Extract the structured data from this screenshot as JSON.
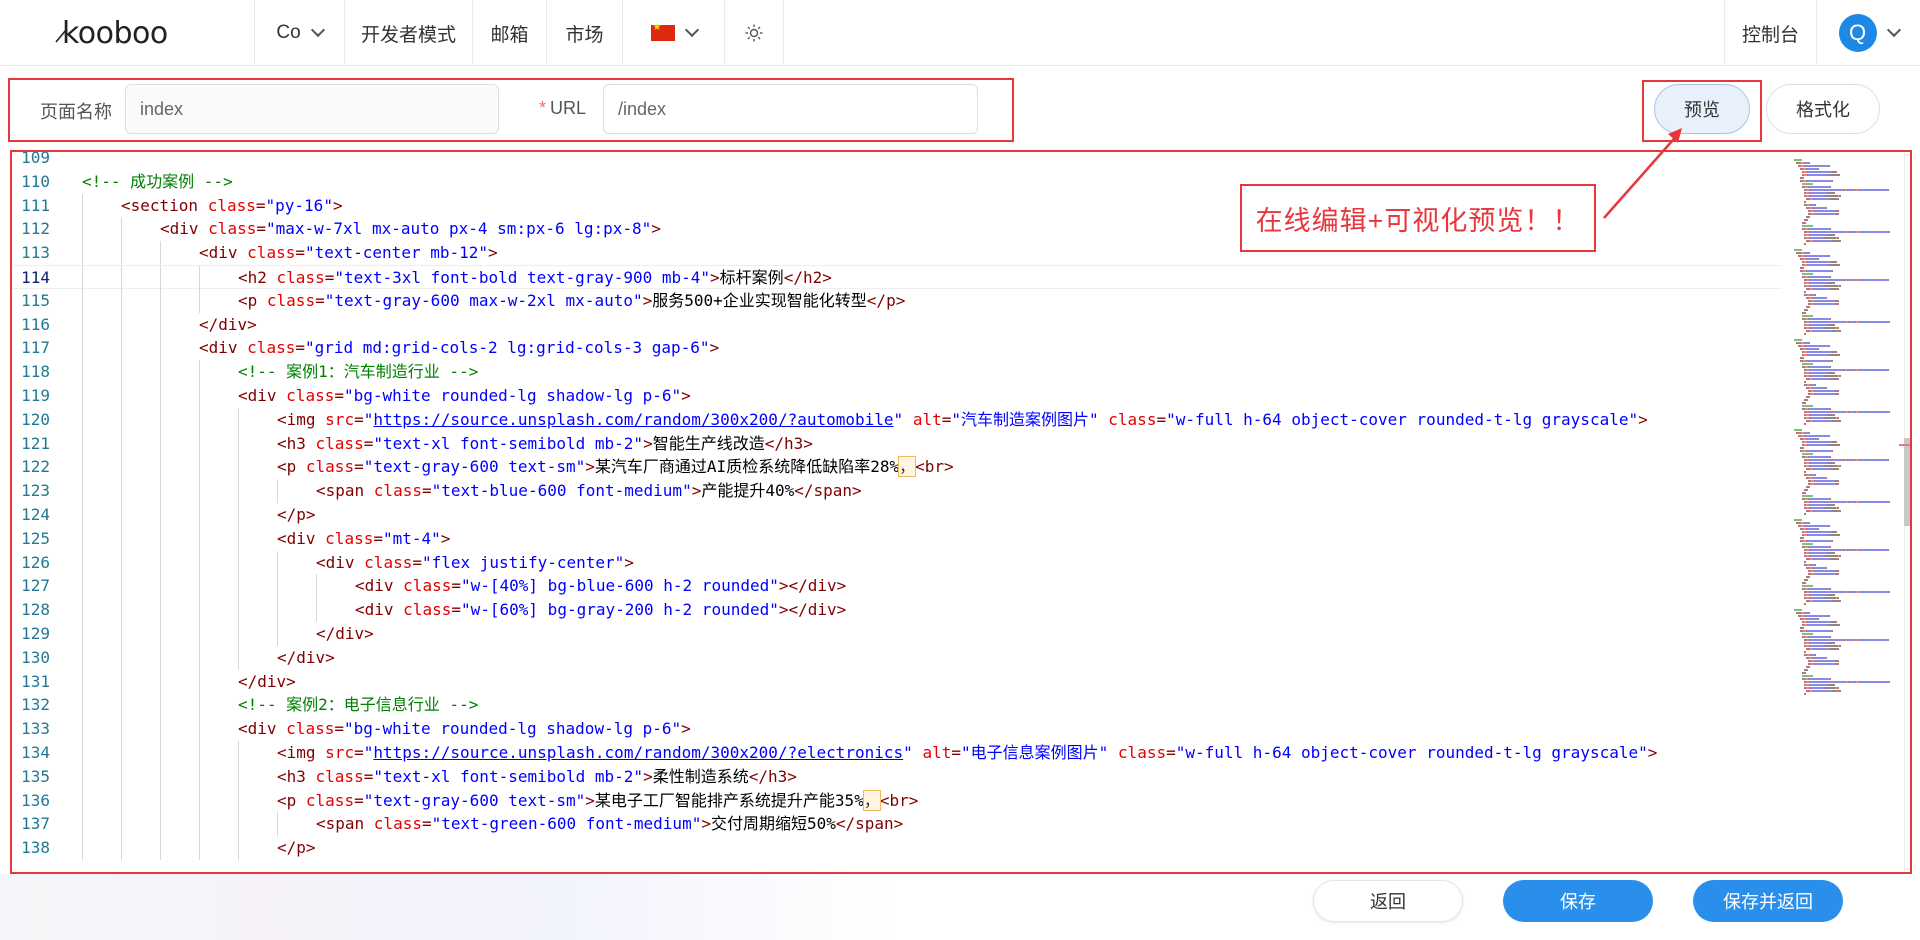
{
  "nav": {
    "logo": "kooboo",
    "lang_short": "Co",
    "dev_mode": "开发者模式",
    "mail": "邮箱",
    "market": "市场",
    "console": "控制台",
    "avatar_letter": "Q"
  },
  "form": {
    "page_name_label": "页面名称",
    "page_name_value": "index",
    "url_required_mark": "*",
    "url_label": "URL",
    "url_value": "/index",
    "preview_button": "预览",
    "format_button": "格式化"
  },
  "annotation": "在线编辑+可视化预览！！",
  "editor": {
    "active_line": 114,
    "lines": [
      {
        "n": "109",
        "indent": 0,
        "tokens": []
      },
      {
        "n": "110",
        "indent": 0,
        "tokens": [
          [
            "cm",
            "<!-- 成功案例 -->"
          ]
        ]
      },
      {
        "n": "111",
        "indent": 1,
        "tokens": [
          [
            "tag",
            "<section "
          ],
          [
            "attr",
            "class"
          ],
          [
            "tag",
            "="
          ],
          [
            "val",
            "\"py-16\""
          ],
          [
            "tag",
            ">"
          ]
        ]
      },
      {
        "n": "112",
        "indent": 2,
        "tokens": [
          [
            "tag",
            "<div "
          ],
          [
            "attr",
            "class"
          ],
          [
            "tag",
            "="
          ],
          [
            "val",
            "\"max-w-7xl mx-auto px-4 sm:px-6 lg:px-8\""
          ],
          [
            "tag",
            ">"
          ]
        ]
      },
      {
        "n": "113",
        "indent": 3,
        "tokens": [
          [
            "tag",
            "<div "
          ],
          [
            "attr",
            "class"
          ],
          [
            "tag",
            "="
          ],
          [
            "val",
            "\"text-center mb-12\""
          ],
          [
            "tag",
            ">"
          ]
        ]
      },
      {
        "n": "114",
        "indent": 4,
        "tokens": [
          [
            "tag",
            "<h2 "
          ],
          [
            "attr",
            "class"
          ],
          [
            "tag",
            "="
          ],
          [
            "val",
            "\"text-3xl font-bold text-gray-900 mb-4\""
          ],
          [
            "tag",
            ">"
          ],
          [
            "txt",
            "标杆案例"
          ],
          [
            "tag",
            "</h2>"
          ]
        ]
      },
      {
        "n": "115",
        "indent": 4,
        "tokens": [
          [
            "tag",
            "<p "
          ],
          [
            "attr",
            "class"
          ],
          [
            "tag",
            "="
          ],
          [
            "val",
            "\"text-gray-600 max-w-2xl mx-auto\""
          ],
          [
            "tag",
            ">"
          ],
          [
            "txt",
            "服务500+企业实现智能化转型"
          ],
          [
            "tag",
            "</p>"
          ]
        ]
      },
      {
        "n": "116",
        "indent": 3,
        "tokens": [
          [
            "tag",
            "</div>"
          ]
        ]
      },
      {
        "n": "117",
        "indent": 3,
        "tokens": [
          [
            "tag",
            "<div "
          ],
          [
            "attr",
            "class"
          ],
          [
            "tag",
            "="
          ],
          [
            "val",
            "\"grid md:grid-cols-2 lg:grid-cols-3 gap-6\""
          ],
          [
            "tag",
            ">"
          ]
        ]
      },
      {
        "n": "118",
        "indent": 4,
        "tokens": [
          [
            "cm",
            "<!-- 案例1：汽车制造行业 -->"
          ]
        ]
      },
      {
        "n": "119",
        "indent": 4,
        "tokens": [
          [
            "tag",
            "<div "
          ],
          [
            "attr",
            "class"
          ],
          [
            "tag",
            "="
          ],
          [
            "val",
            "\"bg-white rounded-lg shadow-lg p-6\""
          ],
          [
            "tag",
            ">"
          ]
        ]
      },
      {
        "n": "120",
        "indent": 5,
        "tokens": [
          [
            "tag",
            "<img "
          ],
          [
            "attr",
            "src"
          ],
          [
            "tag",
            "="
          ],
          [
            "val",
            "\""
          ],
          [
            "link",
            "https://source.unsplash.com/random/300x200/?automobile"
          ],
          [
            "val",
            "\""
          ],
          [
            "tag",
            " "
          ],
          [
            "attr",
            "alt"
          ],
          [
            "tag",
            "="
          ],
          [
            "val",
            "\"汽车制造案例图片\""
          ],
          [
            "tag",
            " "
          ],
          [
            "attr",
            "class"
          ],
          [
            "tag",
            "="
          ],
          [
            "val",
            "\"w-full h-64 object-cover rounded-t-lg grayscale\""
          ],
          [
            "tag",
            ">"
          ]
        ]
      },
      {
        "n": "121",
        "indent": 5,
        "tokens": [
          [
            "tag",
            "<h3 "
          ],
          [
            "attr",
            "class"
          ],
          [
            "tag",
            "="
          ],
          [
            "val",
            "\"text-xl font-semibold mb-2\""
          ],
          [
            "tag",
            ">"
          ],
          [
            "txt",
            "智能生产线改造"
          ],
          [
            "tag",
            "</h3>"
          ]
        ]
      },
      {
        "n": "122",
        "indent": 5,
        "tokens": [
          [
            "tag",
            "<p "
          ],
          [
            "attr",
            "class"
          ],
          [
            "tag",
            "="
          ],
          [
            "val",
            "\"text-gray-600 text-sm\""
          ],
          [
            "tag",
            ">"
          ],
          [
            "txt",
            "某汽车厂商通过AI质检系统降低缺陷率28%"
          ],
          [
            "hl",
            "，"
          ],
          [
            "tag",
            "<br>"
          ]
        ]
      },
      {
        "n": "123",
        "indent": 6,
        "tokens": [
          [
            "tag",
            "<span "
          ],
          [
            "attr",
            "class"
          ],
          [
            "tag",
            "="
          ],
          [
            "val",
            "\"text-blue-600 font-medium\""
          ],
          [
            "tag",
            ">"
          ],
          [
            "txt",
            "产能提升40%"
          ],
          [
            "tag",
            "</span>"
          ]
        ]
      },
      {
        "n": "124",
        "indent": 5,
        "tokens": [
          [
            "tag",
            "</p>"
          ]
        ]
      },
      {
        "n": "125",
        "indent": 5,
        "tokens": [
          [
            "tag",
            "<div "
          ],
          [
            "attr",
            "class"
          ],
          [
            "tag",
            "="
          ],
          [
            "val",
            "\"mt-4\""
          ],
          [
            "tag",
            ">"
          ]
        ]
      },
      {
        "n": "126",
        "indent": 6,
        "tokens": [
          [
            "tag",
            "<div "
          ],
          [
            "attr",
            "class"
          ],
          [
            "tag",
            "="
          ],
          [
            "val",
            "\"flex justify-center\""
          ],
          [
            "tag",
            ">"
          ]
        ]
      },
      {
        "n": "127",
        "indent": 7,
        "tokens": [
          [
            "tag",
            "<div "
          ],
          [
            "attr",
            "class"
          ],
          [
            "tag",
            "="
          ],
          [
            "val",
            "\"w-[40%] bg-blue-600 h-2 rounded\""
          ],
          [
            "tag",
            "></div>"
          ]
        ]
      },
      {
        "n": "128",
        "indent": 7,
        "tokens": [
          [
            "tag",
            "<div "
          ],
          [
            "attr",
            "class"
          ],
          [
            "tag",
            "="
          ],
          [
            "val",
            "\"w-[60%] bg-gray-200 h-2 rounded\""
          ],
          [
            "tag",
            "></div>"
          ]
        ]
      },
      {
        "n": "129",
        "indent": 6,
        "tokens": [
          [
            "tag",
            "</div>"
          ]
        ]
      },
      {
        "n": "130",
        "indent": 5,
        "tokens": [
          [
            "tag",
            "</div>"
          ]
        ]
      },
      {
        "n": "131",
        "indent": 4,
        "tokens": [
          [
            "tag",
            "</div>"
          ]
        ]
      },
      {
        "n": "132",
        "indent": 4,
        "tokens": [
          [
            "cm",
            "<!-- 案例2：电子信息行业 -->"
          ]
        ]
      },
      {
        "n": "133",
        "indent": 4,
        "tokens": [
          [
            "tag",
            "<div "
          ],
          [
            "attr",
            "class"
          ],
          [
            "tag",
            "="
          ],
          [
            "val",
            "\"bg-white rounded-lg shadow-lg p-6\""
          ],
          [
            "tag",
            ">"
          ]
        ]
      },
      {
        "n": "134",
        "indent": 5,
        "tokens": [
          [
            "tag",
            "<img "
          ],
          [
            "attr",
            "src"
          ],
          [
            "tag",
            "="
          ],
          [
            "val",
            "\""
          ],
          [
            "link",
            "https://source.unsplash.com/random/300x200/?electronics"
          ],
          [
            "val",
            "\""
          ],
          [
            "tag",
            " "
          ],
          [
            "attr",
            "alt"
          ],
          [
            "tag",
            "="
          ],
          [
            "val",
            "\"电子信息案例图片\""
          ],
          [
            "tag",
            " "
          ],
          [
            "attr",
            "class"
          ],
          [
            "tag",
            "="
          ],
          [
            "val",
            "\"w-full h-64 object-cover rounded-t-lg grayscale\""
          ],
          [
            "tag",
            ">"
          ]
        ]
      },
      {
        "n": "135",
        "indent": 5,
        "tokens": [
          [
            "tag",
            "<h3 "
          ],
          [
            "attr",
            "class"
          ],
          [
            "tag",
            "="
          ],
          [
            "val",
            "\"text-xl font-semibold mb-2\""
          ],
          [
            "tag",
            ">"
          ],
          [
            "txt",
            "柔性制造系统"
          ],
          [
            "tag",
            "</h3>"
          ]
        ]
      },
      {
        "n": "136",
        "indent": 5,
        "tokens": [
          [
            "tag",
            "<p "
          ],
          [
            "attr",
            "class"
          ],
          [
            "tag",
            "="
          ],
          [
            "val",
            "\"text-gray-600 text-sm\""
          ],
          [
            "tag",
            ">"
          ],
          [
            "txt",
            "某电子工厂智能排产系统提升产能35%"
          ],
          [
            "hl",
            "，"
          ],
          [
            "tag",
            "<br>"
          ]
        ]
      },
      {
        "n": "137",
        "indent": 6,
        "tokens": [
          [
            "tag",
            "<span "
          ],
          [
            "attr",
            "class"
          ],
          [
            "tag",
            "="
          ],
          [
            "val",
            "\"text-green-600 font-medium\""
          ],
          [
            "tag",
            ">"
          ],
          [
            "txt",
            "交付周期缩短50%"
          ],
          [
            "tag",
            "</span>"
          ]
        ]
      },
      {
        "n": "138",
        "indent": 5,
        "tokens": [
          [
            "tag",
            "</p>"
          ]
        ]
      }
    ]
  },
  "bottom": {
    "back": "返回",
    "save": "保存",
    "save_and_back": "保存并返回"
  },
  "colors": {
    "accent_red": "#e8363d",
    "primary_blue": "#2a8fea",
    "avatar_blue": "#1e88e5"
  },
  "icons": [
    "chevron-down-icon",
    "china-flag-icon",
    "sun-icon",
    "avatar"
  ]
}
